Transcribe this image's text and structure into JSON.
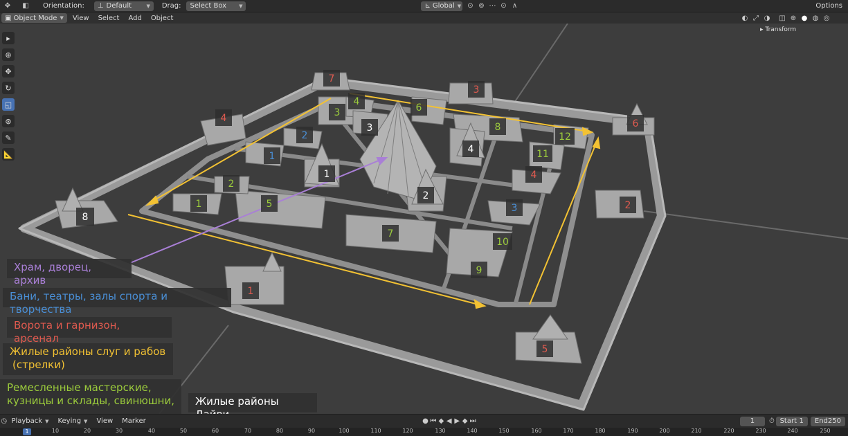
{
  "topbar": {
    "orientation_label": "Orientation:",
    "orientation_value": "Default",
    "drag_label": "Drag:",
    "drag_value": "Select Box",
    "transform_orientation": "Global",
    "options": "Options"
  },
  "header": {
    "mode": "Object Mode",
    "menus": [
      "View",
      "Select",
      "Add",
      "Object"
    ]
  },
  "npanel": {
    "transform_tab": "Transform"
  },
  "scene": {
    "building_labels": [
      {
        "text": "7",
        "color": "#e05a4f"
      },
      {
        "text": "3",
        "color": "#e05a4f"
      },
      {
        "text": "4",
        "color": "#e05a4f"
      },
      {
        "text": "6",
        "color": "#e05a4f"
      },
      {
        "text": "2",
        "color": "#e05a4f"
      },
      {
        "text": "4",
        "color": "#e05a4f"
      },
      {
        "text": "1",
        "color": "#e05a4f"
      },
      {
        "text": "5",
        "color": "#e05a4f"
      },
      {
        "text": "3",
        "color": "#9ccc3c"
      },
      {
        "text": "4",
        "color": "#9ccc3c"
      },
      {
        "text": "6",
        "color": "#9ccc3c"
      },
      {
        "text": "8",
        "color": "#9ccc3c"
      },
      {
        "text": "12",
        "color": "#9ccc3c"
      },
      {
        "text": "11",
        "color": "#9ccc3c"
      },
      {
        "text": "2",
        "color": "#9ccc3c"
      },
      {
        "text": "1",
        "color": "#9ccc3c"
      },
      {
        "text": "5",
        "color": "#9ccc3c"
      },
      {
        "text": "7",
        "color": "#9ccc3c"
      },
      {
        "text": "10",
        "color": "#9ccc3c"
      },
      {
        "text": "9",
        "color": "#9ccc3c"
      },
      {
        "text": "2",
        "color": "#4a8fd6"
      },
      {
        "text": "1",
        "color": "#4a8fd6"
      },
      {
        "text": "3",
        "color": "#4a8fd6"
      },
      {
        "text": "3",
        "color": "#ffffff"
      },
      {
        "text": "4",
        "color": "#ffffff"
      },
      {
        "text": "1",
        "color": "#ffffff"
      },
      {
        "text": "2",
        "color": "#ffffff"
      },
      {
        "text": "8",
        "color": "#ffffff"
      }
    ]
  },
  "legend": {
    "temple": {
      "text": "Храм, дворец, архив",
      "color": "#a97fd6"
    },
    "baths": {
      "text": "Бани, театры, залы спорта и творчества",
      "color": "#4a8fd6"
    },
    "gates": {
      "text": "Ворота и гарнизон, арсенал",
      "color": "#e05a4f"
    },
    "servants_line1": "Жилые районы слуг и рабов",
    "servants_line2": "(стрелки)",
    "servants_color": "#f3c233",
    "crafts_line1": "Ремесленные мастерские,",
    "crafts_line2": "кузницы и склады, свинюшни,",
    "crafts_color": "#9ccc3c",
    "daivi": {
      "text": "Жилые районы Дайви",
      "color": "#ffffff"
    }
  },
  "bottombar": {
    "playback": "Playback",
    "keying": "Keying",
    "view": "View",
    "marker": "Marker",
    "current_frame": "1",
    "start_label": "Start",
    "start_value": "1",
    "end_label": "End",
    "end_value": "250"
  },
  "timeline": {
    "current": "1",
    "ticks": [
      "10",
      "20",
      "30",
      "40",
      "50",
      "60",
      "70",
      "80",
      "90",
      "100",
      "110",
      "120",
      "130",
      "140",
      "150",
      "160",
      "170",
      "180",
      "190",
      "200",
      "210",
      "220",
      "230",
      "240",
      "250"
    ]
  }
}
